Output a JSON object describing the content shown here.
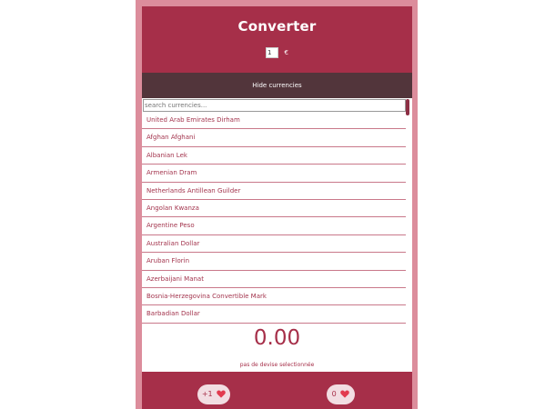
{
  "app": {
    "title": "Converter",
    "amount_value": "1",
    "currency_symbol": "€",
    "toggle_label": "Hide currencies",
    "search_placeholder": "search currencies..."
  },
  "currencies": [
    "United Arab Emirates Dirham",
    "Afghan Afghani",
    "Albanian Lek",
    "Armenian Dram",
    "Netherlands Antillean Guilder",
    "Angolan Kwanza",
    "Argentine Peso",
    "Australian Dollar",
    "Aruban Florin",
    "Azerbaijani Manat",
    "Bosnia-Herzegovina Convertible Mark",
    "Barbadian Dollar"
  ],
  "result": {
    "value": "0.00",
    "note": "pas de devise selectionnée"
  },
  "footer": {
    "left_count": "+1",
    "right_count": "0"
  },
  "colors": {
    "primary": "#a62f49",
    "dark": "#52353b",
    "frame": "#dc8d9c",
    "heart": "#e23b4f"
  }
}
